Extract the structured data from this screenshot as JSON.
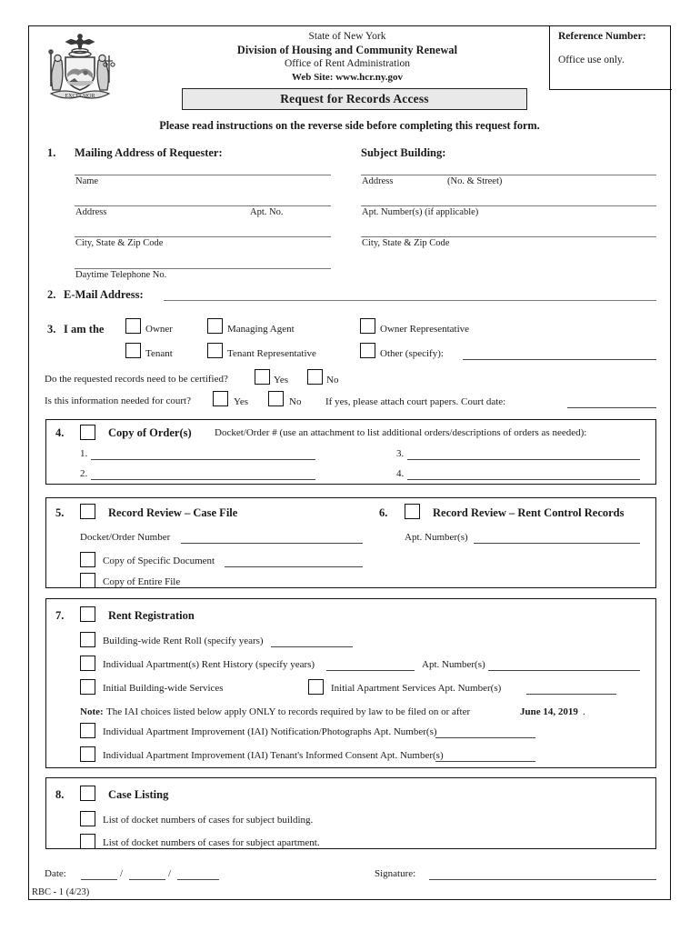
{
  "header": {
    "seal_alt": "new-york-state-seal",
    "org_line1": "State of New York",
    "org_line2": "Division of Housing and Community Renewal",
    "org_line3": "Office of Rent Administration",
    "org_line4": "Web Site:  www.hcr.ny.gov",
    "reference_title": "Reference Number:",
    "reference_sub": "Office use only.",
    "form_title": "Request for Records Access",
    "instruction": "Please read instructions on the reverse side before completing this request form."
  },
  "section1": {
    "number": "1.",
    "requester_heading": "Mailing Address of Requester:",
    "building_heading": "Subject Building:",
    "requester_fields": [
      "Name",
      "Address",
      "Apt. No.",
      "City, State & Zip Code",
      "Daytime Telephone No."
    ],
    "building_fields": [
      "Address",
      "(No. & Street)",
      "Apt. Number(s) (if applicable)",
      "City, State & Zip Code"
    ]
  },
  "section2": {
    "number": "2.",
    "label": "E-Mail Address:"
  },
  "section3": {
    "number": "3.",
    "label": "I am the",
    "options": [
      "Owner",
      "Managing Agent",
      "Owner Representative",
      "Tenant",
      "Tenant Representative",
      "Other (specify):"
    ],
    "certified_question": "Do the requested records need to be certified?",
    "certified_yes": "Yes",
    "certified_no": "No",
    "court_question": "Is this information needed for court?",
    "court_yes": "Yes",
    "court_no": "No",
    "court_note": "If yes, please attach court papers. Court date:"
  },
  "section4": {
    "number": "4.",
    "heading": "Copy of Order(s)",
    "description": "Docket/Order # (use an attachment to list additional orders/descriptions of orders as needed):",
    "items": [
      "1.",
      "2.",
      "3.",
      "4."
    ]
  },
  "section5": {
    "number": "5.",
    "heading": "Record Review – Case File",
    "docket_label": "Docket/Order Number",
    "option_specific": "Copy of Specific Document",
    "option_entire": "Copy of Entire File"
  },
  "section6": {
    "number": "6.",
    "heading": "Record Review – Rent Control Records",
    "apt_label": "Apt. Number(s)"
  },
  "section7": {
    "number": "7.",
    "heading": "Rent Registration",
    "opt_rent_roll": "Building-wide Rent Roll (specify years)",
    "opt_rent_history": "Individual Apartment(s) Rent History (specify years)",
    "opt_rent_history_apt": "Apt. Number(s)",
    "opt_initial_building": "Initial Building-wide Services",
    "opt_initial_apartment": "Initial Apartment Services  Apt. Number(s)",
    "note_prefix": "Note:",
    "note_body": "The IAI choices listed below apply ONLY to records required by law to be filed on or after",
    "note_date": "June 14, 2019",
    "note_period": ".",
    "opt_iai_notification": "Individual Apartment Improvement (IAI) Notification/Photographs  Apt. Number(s)",
    "opt_iai_consent": "Individual Apartment Improvement (IAI) Tenant's Informed Consent  Apt. Number(s)"
  },
  "section8": {
    "number": "8.",
    "heading": "Case Listing",
    "opt_building": "List of docket numbers of cases for subject building.",
    "opt_apartment": "List of docket numbers of cases for subject apartment."
  },
  "footer": {
    "date_label": "Date:",
    "slash1": "/",
    "slash2": "/",
    "signature_label": "Signature:",
    "form_code": "RBC - 1 (4/23)"
  }
}
